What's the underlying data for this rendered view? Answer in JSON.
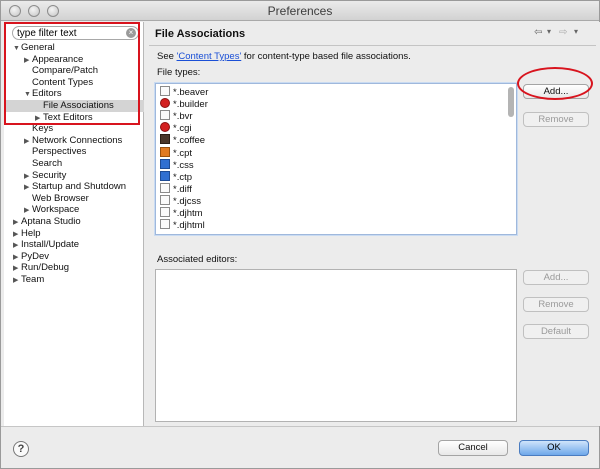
{
  "window": {
    "title": "Preferences"
  },
  "sidebar": {
    "filter_placeholder": "type filter text",
    "tree": [
      {
        "label": "General",
        "expander": "▼"
      },
      {
        "label": "Appearance",
        "expander": "▶"
      },
      {
        "label": "Compare/Patch",
        "expander": ""
      },
      {
        "label": "Content Types",
        "expander": ""
      },
      {
        "label": "Editors",
        "expander": "▼"
      },
      {
        "label": "File Associations",
        "expander": ""
      },
      {
        "label": "Text Editors",
        "expander": "▶"
      },
      {
        "label": "Keys",
        "expander": ""
      },
      {
        "label": "Network Connections",
        "expander": "▶"
      },
      {
        "label": "Perspectives",
        "expander": ""
      },
      {
        "label": "Search",
        "expander": ""
      },
      {
        "label": "Security",
        "expander": "▶"
      },
      {
        "label": "Startup and Shutdown",
        "expander": "▶"
      },
      {
        "label": "Web Browser",
        "expander": ""
      },
      {
        "label": "Workspace",
        "expander": "▶"
      },
      {
        "label": "Aptana Studio",
        "expander": "▶"
      },
      {
        "label": "Help",
        "expander": "▶"
      },
      {
        "label": "Install/Update",
        "expander": "▶"
      },
      {
        "label": "PyDev",
        "expander": "▶"
      },
      {
        "label": "Run/Debug",
        "expander": "▶"
      },
      {
        "label": "Team",
        "expander": "▶"
      }
    ]
  },
  "main": {
    "heading": "File Associations",
    "nav_back": "⇦",
    "nav_forward": "⇨",
    "nav_menu": "▾",
    "see_prefix": "See ",
    "see_link": "'Content Types'",
    "see_suffix": " for content-type based file associations.",
    "file_types_label": "File types:",
    "file_types": [
      {
        "name": "*.beaver",
        "icon": "document-icon"
      },
      {
        "name": "*.builder",
        "icon": "ruby-icon"
      },
      {
        "name": "*.bvr",
        "icon": "document-icon"
      },
      {
        "name": "*.cgi",
        "icon": "ruby-icon"
      },
      {
        "name": "*.coffee",
        "icon": "coffee-icon"
      },
      {
        "name": "*.cpt",
        "icon": "image-icon"
      },
      {
        "name": "*.css",
        "icon": "css-icon"
      },
      {
        "name": "*.ctp",
        "icon": "php-icon"
      },
      {
        "name": "*.diff",
        "icon": "document-icon"
      },
      {
        "name": "*.djcss",
        "icon": "document-icon"
      },
      {
        "name": "*.djhtm",
        "icon": "document-icon"
      },
      {
        "name": "*.djhtml",
        "icon": "document-icon"
      }
    ],
    "add_button": "Add...",
    "remove_button": "Remove",
    "associated_label": "Associated editors:",
    "assoc_add_button": "Add...",
    "assoc_remove_button": "Remove",
    "default_button": "Default"
  },
  "footer": {
    "help": "?",
    "cancel": "Cancel",
    "ok": "OK"
  },
  "colors": {
    "highlight": "#d8141e",
    "link": "#1a4fd6",
    "primary_button": "#6ea8ea"
  }
}
